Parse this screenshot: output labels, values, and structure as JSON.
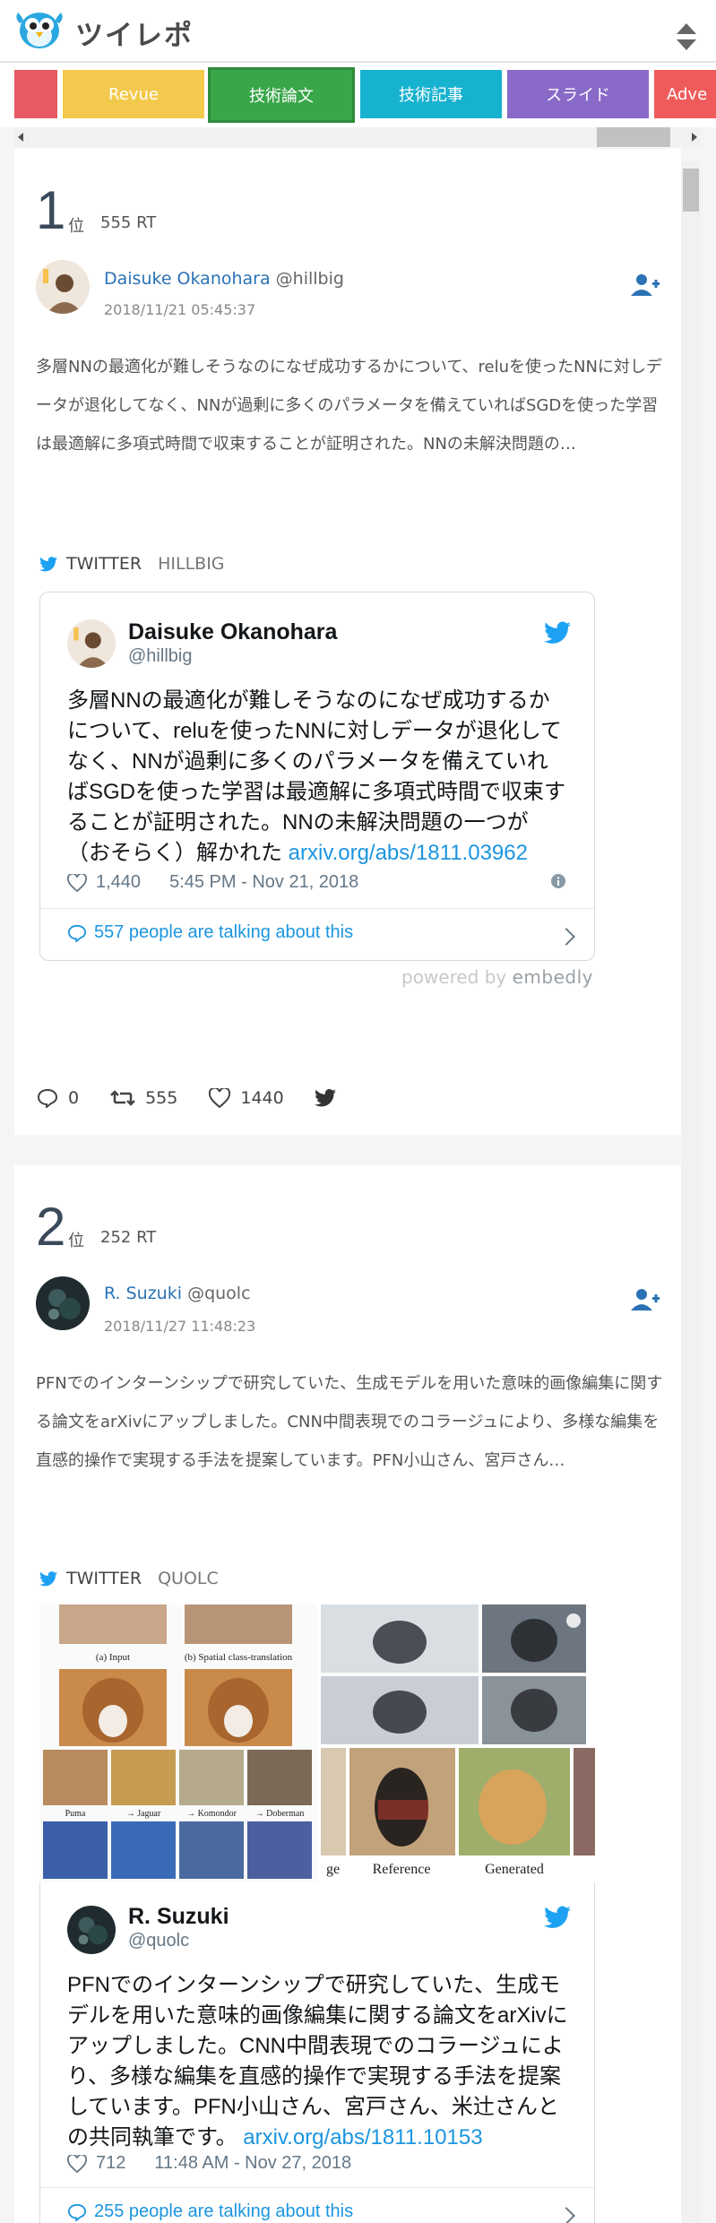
{
  "app": {
    "title": "ツイレポ"
  },
  "tabs": [
    {
      "label": "",
      "color": "#e75a62"
    },
    {
      "label": "Revue",
      "color": "#f2c94c"
    },
    {
      "label": "技術論文",
      "color": "#3aa64a"
    },
    {
      "label": "技術記事",
      "color": "#17b2cf"
    },
    {
      "label": "スライド",
      "color": "#8a6ac8"
    },
    {
      "label": "Adve",
      "color": "#ef5b5b"
    }
  ],
  "entries": [
    {
      "rank": "1",
      "rank_unit": "位",
      "rt": "555 RT",
      "author_name": "Daisuke Okanohara",
      "author_handle": "@hillbig",
      "date": "2018/11/21 05:45:37",
      "excerpt": "多層NNの最適化が難しそうなのになぜ成功するかについて、reluを使ったNNに対しデータが退化してなく、NNが過剰に多くのパラメータを備えていればSGDを使った学習は最適解に多項式時間で収束することが証明された。NNの未解決問題の…",
      "embed_label": "TWITTER",
      "embed_handle": "HILLBIG",
      "tweet": {
        "name": "Daisuke Okanohara",
        "handle": "@hillbig",
        "text": "多層NNの最適化が難しそうなのになぜ成功するかについて、reluを使ったNNに対しデータが退化してなく、NNが過剰に多くのパラメータを備えていればSGDを使った学習は最適解に多項式時間で収束することが証明された。NNの未解決問題の一つが（おそらく）解かれた",
        "link": "arxiv.org/abs/1811.03962",
        "likes": "1,440",
        "time": "5:45 PM - Nov 21, 2018",
        "talking": "557 people are talking about this"
      },
      "powered_prefix": "powered by",
      "powered_brand": "embedly",
      "replies": "0",
      "retweets": "555",
      "favs": "1440"
    },
    {
      "rank": "2",
      "rank_unit": "位",
      "rt": "252 RT",
      "author_name": "R. Suzuki",
      "author_handle": "@quolc",
      "date": "2018/11/27 11:48:23",
      "excerpt": "PFNでのインターンシップで研究していた、生成モデルを用いた意味的画像編集に関する論文をarXivにアップしました。CNN中間表現でのコラージュにより、多様な編集を直感的操作で実現する手法を提案しています。PFN小山さん、宮戸さん…",
      "embed_label": "TWITTER",
      "embed_handle": "QUOLC",
      "media_captions": [
        "(a) Input",
        "(b) Spatial class-translation",
        "Puma",
        "→ Jaguar",
        "→ Komondor",
        "→ Doberman",
        "ge",
        "Reference",
        "Generated"
      ],
      "tweet": {
        "name": "R. Suzuki",
        "handle": "@quolc",
        "text": "PFNでのインターンシップで研究していた、生成モデルを用いた意味的画像編集に関する論文をarXivにアップしました。CNN中間表現でのコラージュにより、多様な編集を直感的操作で実現する手法を提案しています。PFN小山さん、宮戸さん、米辻さんとの共同執筆です。",
        "link": "arxiv.org/abs/1811.10153",
        "likes": "712",
        "time": "11:48 AM - Nov 27, 2018",
        "talking": "255 people are talking about this"
      }
    }
  ],
  "colors": {
    "link": "#2a72b5",
    "twitter": "#1da1f2",
    "rank": "#3a4a5a"
  }
}
